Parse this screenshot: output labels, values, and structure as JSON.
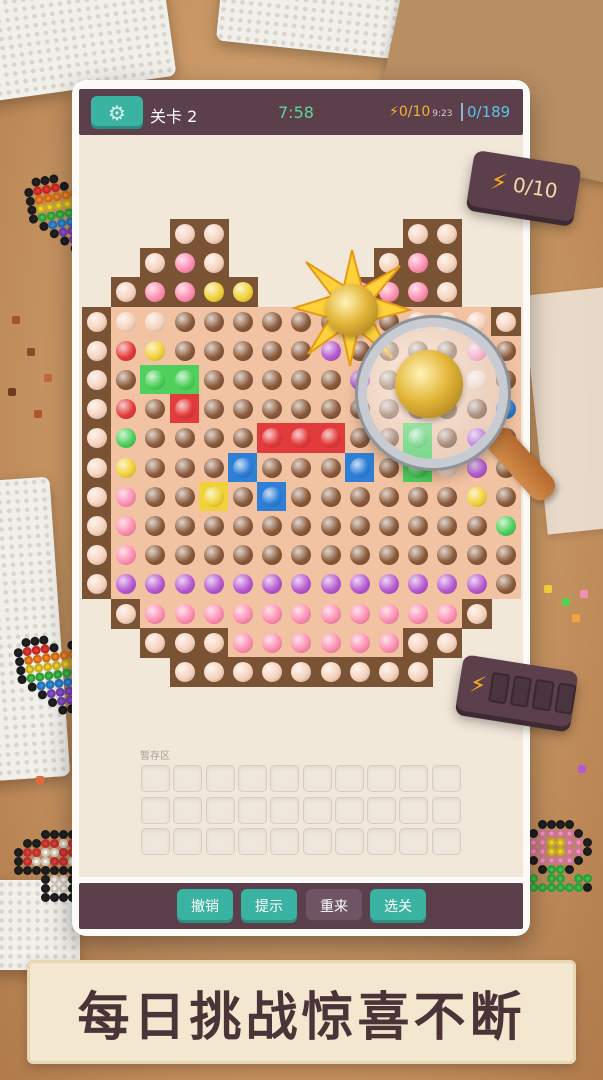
{
  "header": {
    "level_label": "关卡 2",
    "timer": "7:58",
    "energy": "0/10",
    "energy_timer": "9:23",
    "progress": "0/189"
  },
  "badges": {
    "energy_text": "0/10"
  },
  "stash": {
    "label": "暂存区",
    "rows": 3,
    "cols": 10
  },
  "buttons": {
    "undo": "撤销",
    "hint": "提示",
    "restart": "重来",
    "select_level": "选关"
  },
  "caption": "每日挑战惊喜不断",
  "colors": {
    "frame_dark": "#5b3f4b",
    "teal_button": "#3bb3a2",
    "purple_button": "#6f5464",
    "cell_brown": "#7a5234",
    "cell_peach": "#f2c3a2",
    "bead_peach": "#f6d3bd",
    "bead_brown": "#8a5a3b",
    "bead_pink": "#ff8fb2",
    "bead_purple": "#b65ad0",
    "bead_red": "#e23b3b",
    "bead_green": "#4fcf5b",
    "bead_yellow": "#f1d23a",
    "bead_blue": "#2f7fd6"
  },
  "icons": [
    "gear-icon",
    "lightning-icon",
    "magnifier-icon"
  ]
}
